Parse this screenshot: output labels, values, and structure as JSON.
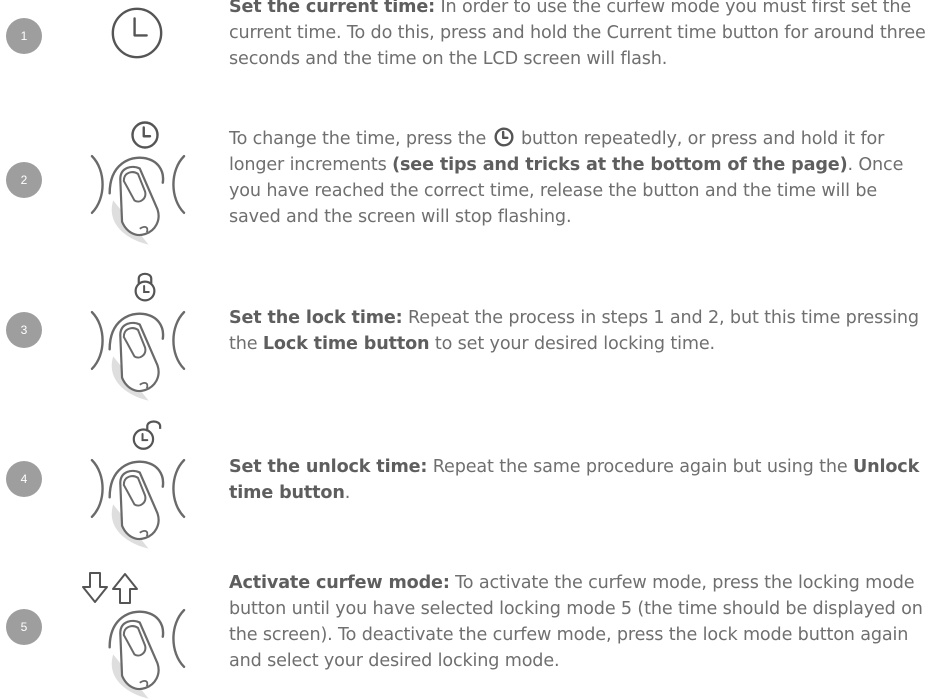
{
  "steps": [
    {
      "number": "1",
      "icon": "clock-icon",
      "bold": "Set the current time:",
      "text": " In order to use the curfew mode you must first set the current time. To do this, press and hold the Current time button for around three seconds and the time on the LCD screen will flash."
    },
    {
      "number": "2",
      "icon": "press-clock-button-icon",
      "text_a": "To change the time, press the ",
      "text_b": " button repeatedly, or press and hold it for longer increments ",
      "bold": "(see tips and tricks at the bottom of the page)",
      "text_c": ". Once you have reached the correct time, release the button and the time will be saved and the screen will stop flashing."
    },
    {
      "number": "3",
      "icon": "press-lock-button-icon",
      "bold": "Set the lock time:",
      "text_a": " Repeat the process in steps 1 and 2, but this time pressing the ",
      "bold2": "Lock time button",
      "text_b": " to set your desired locking time."
    },
    {
      "number": "4",
      "icon": "press-unlock-button-icon",
      "bold": "Set the unlock time:",
      "text_a": " Repeat the same procedure again but using the ",
      "bold2": "Unlock time button",
      "text_b": "."
    },
    {
      "number": "5",
      "icon": "press-arrows-button-icon",
      "bold": "Activate curfew mode:",
      "text": " To activate the curfew mode, press the locking mode button until you have selected locking mode 5 (the time should be displayed on the screen). To deactivate the curfew mode, press the lock mode button again and select your desired locking mode."
    }
  ],
  "colors": {
    "text": "#6f6f6f",
    "bold": "#5e5e5e",
    "badge": "#9e9e9e"
  }
}
